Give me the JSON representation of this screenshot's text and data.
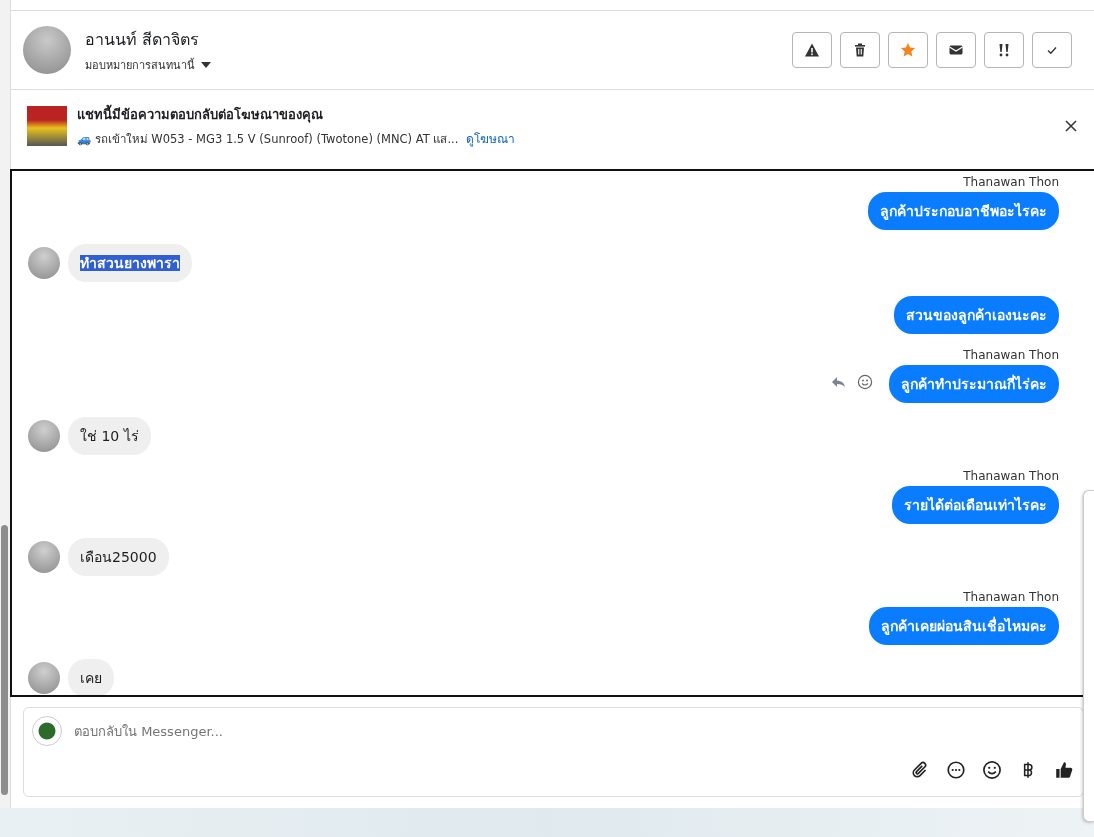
{
  "header": {
    "name": "อานนท์ สีดาจิตร",
    "assign_label": "มอบหมายการสนทนานี้",
    "actions": [
      {
        "kind": "spam",
        "on": false
      },
      {
        "kind": "delete",
        "on": false
      },
      {
        "kind": "star",
        "on": true
      },
      {
        "kind": "unread",
        "on": false
      },
      {
        "kind": "important",
        "on": false
      },
      {
        "kind": "done",
        "on": false
      }
    ]
  },
  "ad_banner": {
    "title": "แชทนี้มีข้อความตอบกลับต่อโฆษณาของคุณ",
    "subtitle": "🚙 รถเข้าใหม่ W053 - MG3 1.5 V (Sunroof) (Twotone) (MNC) AT แส...",
    "link": "ดูโฆษณา"
  },
  "messages": [
    {
      "kind": "outgoing",
      "sender": "Thanawan Thon",
      "text": "ลูกค้าประกอบอาชีพอะไรคะ",
      "highlighted": false,
      "show_actions": false
    },
    {
      "kind": "incoming",
      "text": "ทำสวนยางพารา",
      "highlighted": true,
      "show_actions": false
    },
    {
      "kind": "outgoing",
      "text": "สวนของลูกค้าเองนะคะ",
      "highlighted": false,
      "show_actions": false
    },
    {
      "kind": "outgoing",
      "sender": "Thanawan Thon",
      "text": "ลูกค้าทำประมาณกี่ไร่คะ",
      "highlighted": false,
      "show_actions": true
    },
    {
      "kind": "incoming",
      "text": "ใช่ 10 ไร่",
      "highlighted": false,
      "show_actions": false
    },
    {
      "kind": "outgoing",
      "sender": "Thanawan Thon",
      "text": "รายได้ต่อเดือนเท่าไรคะ",
      "highlighted": false,
      "show_actions": false
    },
    {
      "kind": "incoming",
      "text": "เดือน25000",
      "highlighted": false,
      "show_actions": false
    },
    {
      "kind": "outgoing",
      "sender": "Thanawan Thon",
      "text": "ลูกค้าเคยผ่อนสินเชื่อไหมคะ",
      "highlighted": false,
      "show_actions": false
    },
    {
      "kind": "incoming",
      "text": "เคย",
      "highlighted": false,
      "show_actions": false
    }
  ],
  "composer": {
    "placeholder": "ตอบกลับใน Messenger..."
  }
}
